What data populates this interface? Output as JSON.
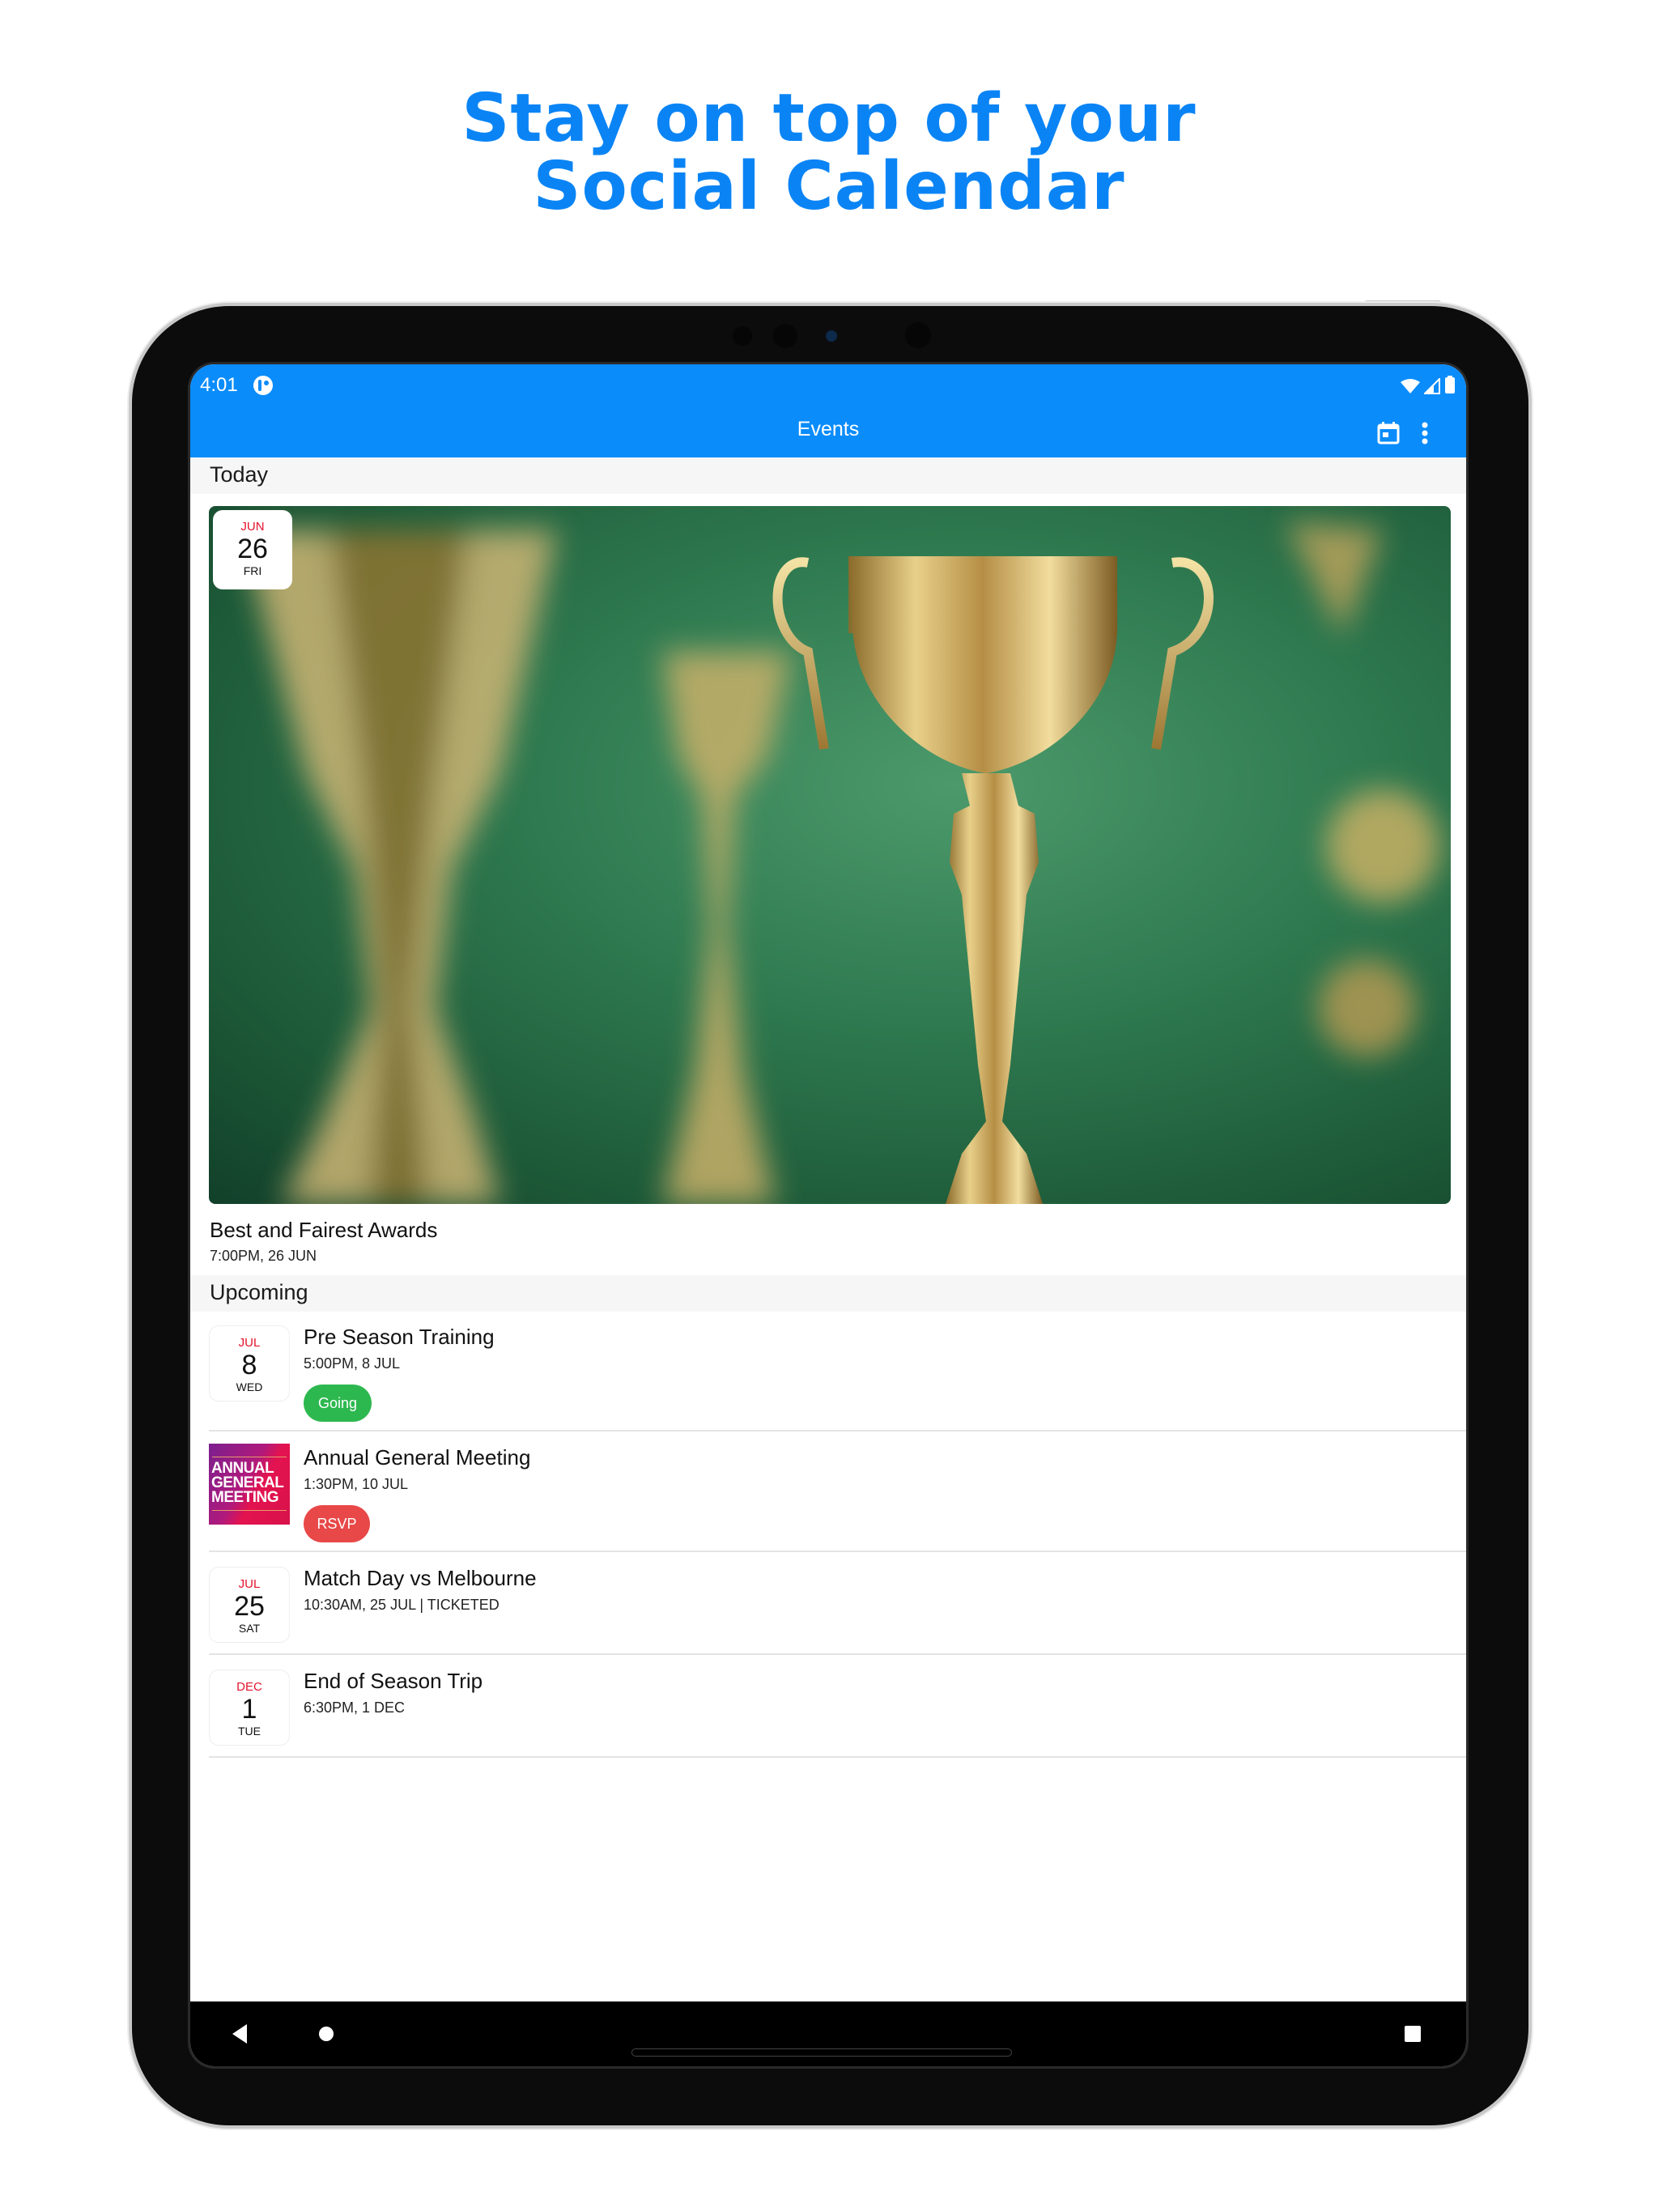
{
  "headline": {
    "line1": "Stay on top of your",
    "line2": "Social Calendar"
  },
  "colors": {
    "accent": "#0a8cfb",
    "headline": "#0a84f5",
    "going": "#2db84f",
    "rsvp": "#e84848",
    "month_red": "#e3132b"
  },
  "status_bar": {
    "time": "4:01",
    "icons": [
      "app-notification-icon",
      "wifi-icon",
      "cell-signal-icon",
      "battery-icon"
    ]
  },
  "app_bar": {
    "title": "Events",
    "actions": [
      "calendar-icon",
      "more-vert-icon"
    ]
  },
  "today": {
    "header": "Today",
    "featured": {
      "badge": {
        "month": "JUN",
        "day": "26",
        "dow": "FRI"
      },
      "image": "trophy-photo",
      "title": "Best and Fairest Awards",
      "subtitle": "7:00PM, 26 JUN"
    }
  },
  "upcoming": {
    "header": "Upcoming",
    "events": [
      {
        "badge": {
          "month": "JUL",
          "day": "8",
          "dow": "WED"
        },
        "title": "Pre Season Training",
        "subtitle": "5:00PM, 8 JUL",
        "pill": "Going"
      },
      {
        "thumbnail": {
          "line1": "ANNUAL",
          "line2": "GENERAL",
          "line3": "MEETING"
        },
        "title": "Annual General Meeting",
        "subtitle": "1:30PM, 10 JUL",
        "pill": "RSVP"
      },
      {
        "badge": {
          "month": "JUL",
          "day": "25",
          "dow": "SAT"
        },
        "title": "Match Day vs Melbourne",
        "subtitle": "10:30AM, 25 JUL | TICKETED"
      },
      {
        "badge": {
          "month": "DEC",
          "day": "1",
          "dow": "TUE"
        },
        "title": "End of Season Trip",
        "subtitle": "6:30PM, 1 DEC"
      }
    ]
  },
  "nav_bar": {
    "buttons": [
      "back-icon",
      "home-icon",
      "recents-icon"
    ]
  }
}
